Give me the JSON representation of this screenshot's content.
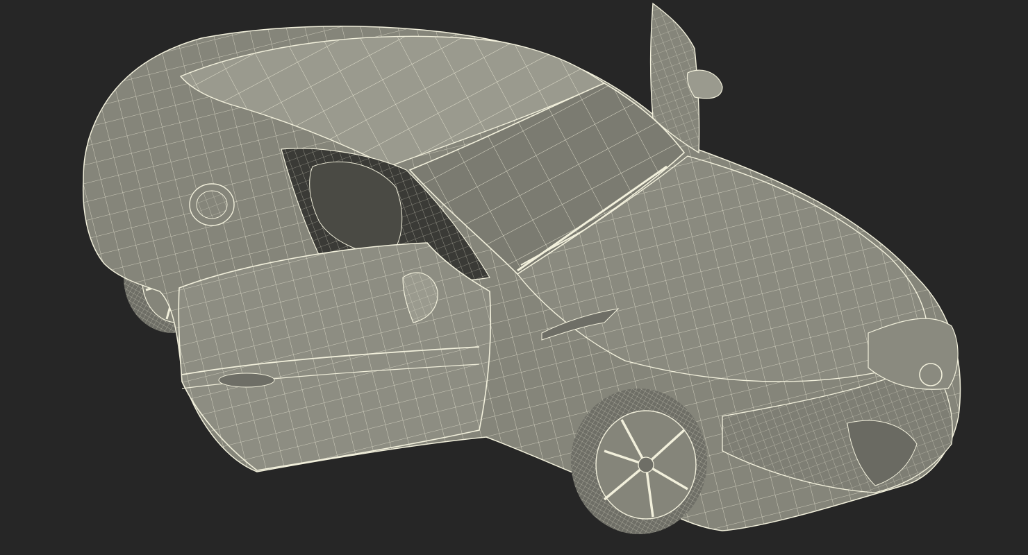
{
  "scene": {
    "subject": "car-wireframe-render",
    "colors": {
      "background": "#262626",
      "surface": "#85857a",
      "surface_dark": "#5e5e56",
      "surface_light": "#9a9a8e",
      "wire": "#f2f0dc",
      "interior": "#3a3a36",
      "tire": "#6e6e66"
    }
  }
}
